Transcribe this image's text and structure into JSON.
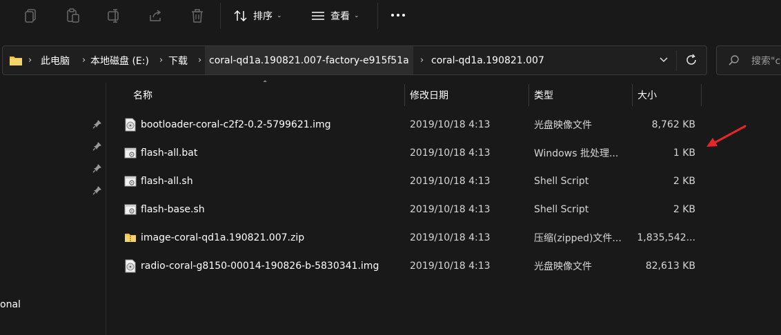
{
  "toolbar": {
    "icons": [
      "copy-icon",
      "paste-icon",
      "rename-icon",
      "share-icon",
      "delete-icon"
    ],
    "sort_label": "排序",
    "view_label": "查看",
    "more_icon": "more-icon"
  },
  "address": {
    "crumbs": [
      "此电脑",
      "本地磁盘 (E:)",
      "下载",
      "coral-qd1a.190821.007-factory-e915f51a",
      "coral-qd1a.190821.007"
    ]
  },
  "search": {
    "placeholder": "搜索\"c"
  },
  "nav": {
    "partial_label": "onal"
  },
  "columns": {
    "name": "名称",
    "date": "修改日期",
    "type": "类型",
    "size": "大小"
  },
  "files": [
    {
      "name": "bootloader-coral-c2f2-0.2-5799621.img",
      "date": "2019/10/18 4:13",
      "type": "光盘映像文件",
      "size": "8,762 KB",
      "icon": "disc-image-icon"
    },
    {
      "name": "flash-all.bat",
      "date": "2019/10/18 4:13",
      "type": "Windows 批处理...",
      "size": "1 KB",
      "icon": "script-file-icon"
    },
    {
      "name": "flash-all.sh",
      "date": "2019/10/18 4:13",
      "type": "Shell Script",
      "size": "2 KB",
      "icon": "script-file-icon"
    },
    {
      "name": "flash-base.sh",
      "date": "2019/10/18 4:13",
      "type": "Shell Script",
      "size": "2 KB",
      "icon": "script-file-icon"
    },
    {
      "name": "image-coral-qd1a.190821.007.zip",
      "date": "2019/10/18 4:13",
      "type": "压缩(zipped)文件...",
      "size": "1,835,542...",
      "icon": "zip-folder-icon"
    },
    {
      "name": "radio-coral-g8150-00014-190826-b-5830341.img",
      "date": "2019/10/18 4:13",
      "type": "光盘映像文件",
      "size": "82,613 KB",
      "icon": "disc-image-icon"
    }
  ],
  "colors": {
    "background": "#191919",
    "annotation_arrow": "#e8262a",
    "folder": "#f3c245"
  }
}
